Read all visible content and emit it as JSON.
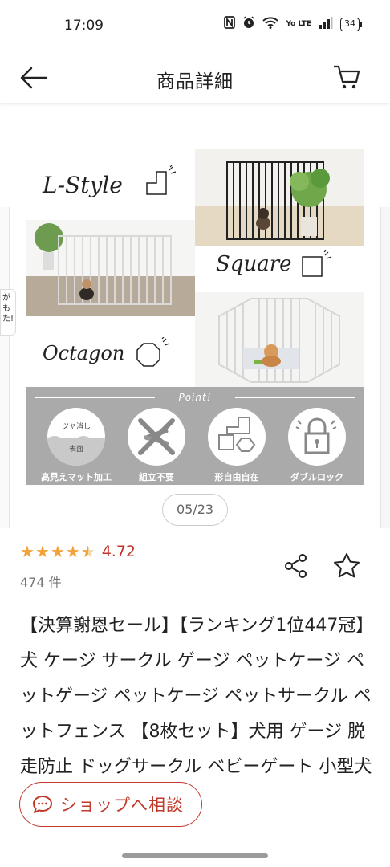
{
  "status_bar": {
    "time": "17:09",
    "network_label": "Yo LTE",
    "battery": "34",
    "icons": [
      "nfc-icon",
      "alarm-icon",
      "wifi-icon",
      "signal-icon",
      "battery-icon"
    ]
  },
  "header": {
    "title": "商品詳細",
    "back_icon": "arrow-left-icon",
    "cart_icon": "cart-icon"
  },
  "gallery": {
    "side_badge_text": "がも た!",
    "image": {
      "labels": {
        "l_style": "L-Style",
        "square": "Square",
        "octagon": "Octagon"
      },
      "point_title": "Point!",
      "features": [
        {
          "label": "高見えマット加工",
          "badge_top": "ツヤ消し",
          "badge_bottom": "表面",
          "icon": "matte-finish-icon"
        },
        {
          "label": "組立不要",
          "icon": "no-tools-icon"
        },
        {
          "label": "形自由自在",
          "icon": "shapes-icon"
        },
        {
          "label": "ダブルロック",
          "icon": "lock-icon"
        }
      ]
    },
    "counter": "05/23"
  },
  "rating": {
    "value": "4.72",
    "stars": 4.5,
    "review_count": "474 件"
  },
  "actions": {
    "share_icon": "share-icon",
    "favorite_icon": "star-outline-icon"
  },
  "product": {
    "title": "【決算謝恩セール】【ランキング1位447冠】 犬 ケージ サークル ゲージ ペットケージ ペットゲージ ペットケージ ペットサークル ペットフェンス 【8枚セット】犬用 ゲージ 脱走防止 ドッグサークル ベビーゲート 小型犬 中型犬 mybest"
  },
  "chat_button": {
    "label": "ショップへ相談",
    "icon": "chat-bubble-icon"
  },
  "colors": {
    "accent_red": "#c0392b",
    "rating_red": "#c3352c",
    "star_orange": "#f2a33a",
    "panel_gray": "#aaaaab"
  }
}
